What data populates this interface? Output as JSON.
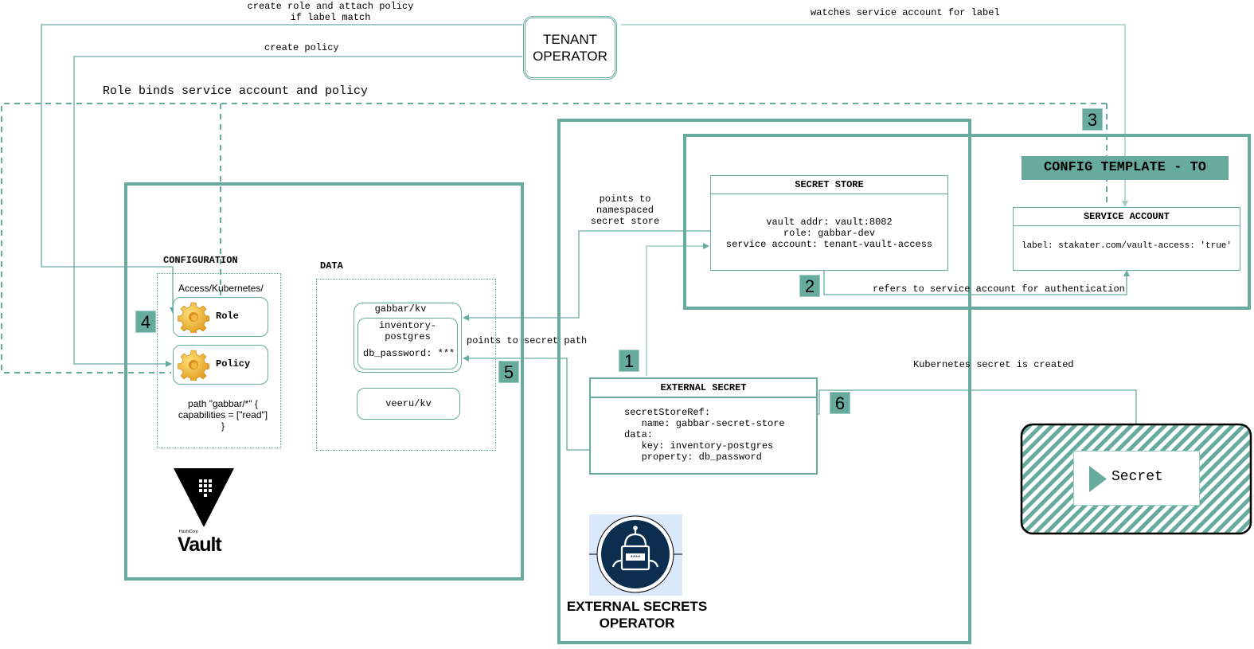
{
  "colors": {
    "accent": "#67AB9F",
    "accent_light": "#9FCFC5",
    "dark": "#000000",
    "robot_bg": "#DAE8FC",
    "robot_navy": "#0B2E4F"
  },
  "tenant_operator": {
    "label_line1": "TENANT",
    "label_line2": "OPERATOR"
  },
  "edge_labels": {
    "create_role_line1": "create role and attach policy",
    "create_role_line2": "if label match",
    "create_policy": "create policy",
    "watches_sa": "watches service account for label",
    "role_binds": "Role binds service account and policy",
    "points_to_store_line1": "points to",
    "points_to_store_line2": "namespaced",
    "points_to_store_line3": "secret store",
    "refers_sa": "refers to service account for authentication",
    "points_to_secret_path": "points to secret path",
    "k8s_secret_created": "Kubernetes secret is created"
  },
  "steps": [
    "1",
    "2",
    "3",
    "4",
    "5",
    "6"
  ],
  "vault": {
    "configuration_title": "CONFIGURATION",
    "config_path": "Access/Kubernetes/",
    "role_label": "Role",
    "policy_label": "Policy",
    "policy_text_line1": "path \"gabbar/*\" {",
    "policy_text_line2": "capabilities = [\"read\"]",
    "policy_text_line3": "}",
    "data_title": "DATA",
    "kv1_name": "gabbar/kv",
    "kv1_secret_line1": "inventory-",
    "kv1_secret_line2": "postgres",
    "kv1_secret_field": "db_password: ***",
    "kv2_name": "veeru/kv",
    "logo_small": "HashiCorp",
    "logo_big": "Vault"
  },
  "secret_store": {
    "title": "SECRET STORE",
    "line1": "vault addr: vault:8082",
    "line2": "role: gabbar-dev",
    "line3": "service account: tenant-vault-access"
  },
  "config_template": {
    "title": "CONFIG TEMPLATE - TO"
  },
  "service_account": {
    "title": "SERVICE ACCOUNT",
    "label": "label: stakater.com/vault-access: 'true'"
  },
  "external_secret": {
    "title": "EXTERNAL SECRET",
    "body": "secretStoreRef:\n   name: gabbar-secret-store\ndata:\n   key: inventory-postgres\n   property: db_password"
  },
  "k8s_secret": {
    "label": "Secret"
  },
  "eso": {
    "label_line1": "EXTERNAL SECRETS",
    "label_line2": "OPERATOR",
    "badge_text": "****"
  }
}
